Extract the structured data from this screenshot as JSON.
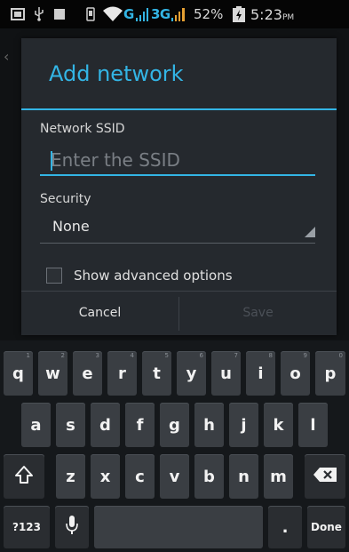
{
  "status_bar": {
    "network_letter": "G",
    "network_3g": "3G",
    "battery_percent": "52%",
    "time": "5:23",
    "time_ampm": "PM"
  },
  "dialog": {
    "title": "Add network",
    "ssid_label": "Network SSID",
    "ssid_placeholder": "Enter the SSID",
    "ssid_value": "",
    "security_label": "Security",
    "security_value": "None",
    "show_advanced_label": "Show advanced options",
    "show_advanced_checked": false,
    "cancel_label": "Cancel",
    "save_label": "Save"
  },
  "keyboard": {
    "row1": [
      {
        "k": "q",
        "hint": "1"
      },
      {
        "k": "w",
        "hint": "2"
      },
      {
        "k": "e",
        "hint": "3"
      },
      {
        "k": "r",
        "hint": "4"
      },
      {
        "k": "t",
        "hint": "5"
      },
      {
        "k": "y",
        "hint": "6"
      },
      {
        "k": "u",
        "hint": "7"
      },
      {
        "k": "i",
        "hint": "8"
      },
      {
        "k": "o",
        "hint": "9"
      },
      {
        "k": "p",
        "hint": "0"
      }
    ],
    "row2": [
      "a",
      "s",
      "d",
      "f",
      "g",
      "h",
      "j",
      "k",
      "l"
    ],
    "row3": [
      "z",
      "x",
      "c",
      "v",
      "b",
      "n",
      "m"
    ],
    "symbols_label": "?123",
    "period_label": ".",
    "done_label": "Done"
  },
  "colors": {
    "accent": "#33b5e5",
    "dialog_bg": "#25292e",
    "key_bg": "#3a3e43"
  }
}
